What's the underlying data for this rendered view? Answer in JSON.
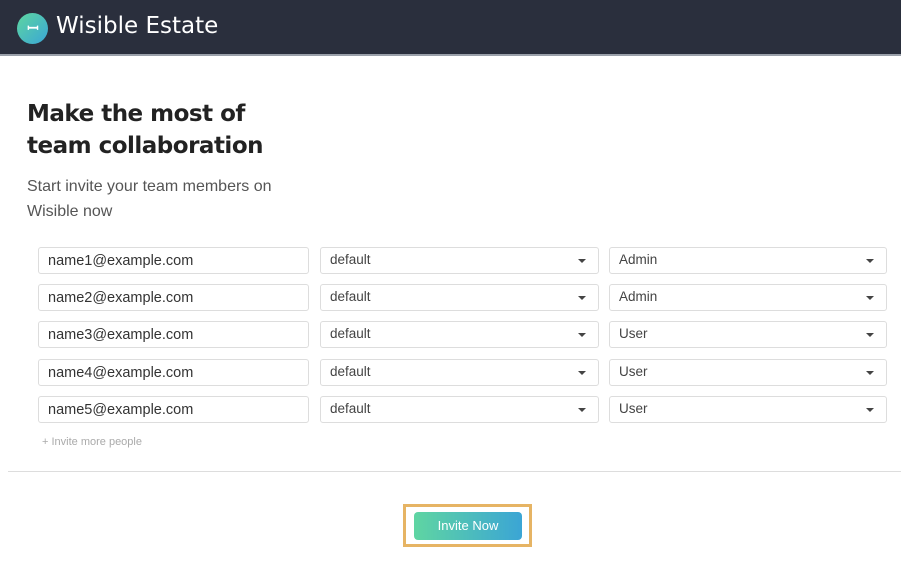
{
  "header": {
    "logo_text": "W",
    "title": "Wisible Estate"
  },
  "intro": {
    "heading": "Make the most of team collaboration",
    "subtitle": "Start invite your team members on Wisible now"
  },
  "rows": [
    {
      "email": "name1@example.com",
      "group": "default",
      "role": "Admin"
    },
    {
      "email": "name2@example.com",
      "group": "default",
      "role": "Admin"
    },
    {
      "email": "name3@example.com",
      "group": "default",
      "role": "User"
    },
    {
      "email": "name4@example.com",
      "group": "default",
      "role": "User"
    },
    {
      "email": "name5@example.com",
      "group": "default",
      "role": "User"
    }
  ],
  "invite_more_label": "+ Invite more people",
  "invite_button_label": "Invite Now",
  "colors": {
    "header_bg": "#2a2f3d",
    "button_gradient_start": "#5fd5a2",
    "button_gradient_end": "#3ba5d5",
    "highlight": "#e6b464"
  }
}
